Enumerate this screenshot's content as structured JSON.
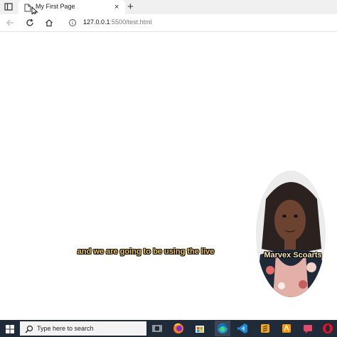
{
  "browser": {
    "tab": {
      "title": "My First Page",
      "close_glyph": "×",
      "favicon": "page-icon"
    },
    "new_tab_glyph": "+",
    "address": {
      "host": "127.0.0.1",
      "rest": ":5500/test.html"
    }
  },
  "video": {
    "caption": "and we are going to be using the live",
    "presenter_name": "Marvex Scoarts"
  },
  "taskbar": {
    "search_placeholder": "Type here to search",
    "apps": [
      "task-view-icon",
      "firefox-icon",
      "store-icon",
      "edge-icon",
      "vscode-icon",
      "sublime-icon",
      "app-icon",
      "chat-icon",
      "opera-icon"
    ]
  },
  "colors": {
    "caption": "#f4c94f",
    "taskbar": "#202b3a",
    "tab_strip": "#f0f0f0"
  }
}
